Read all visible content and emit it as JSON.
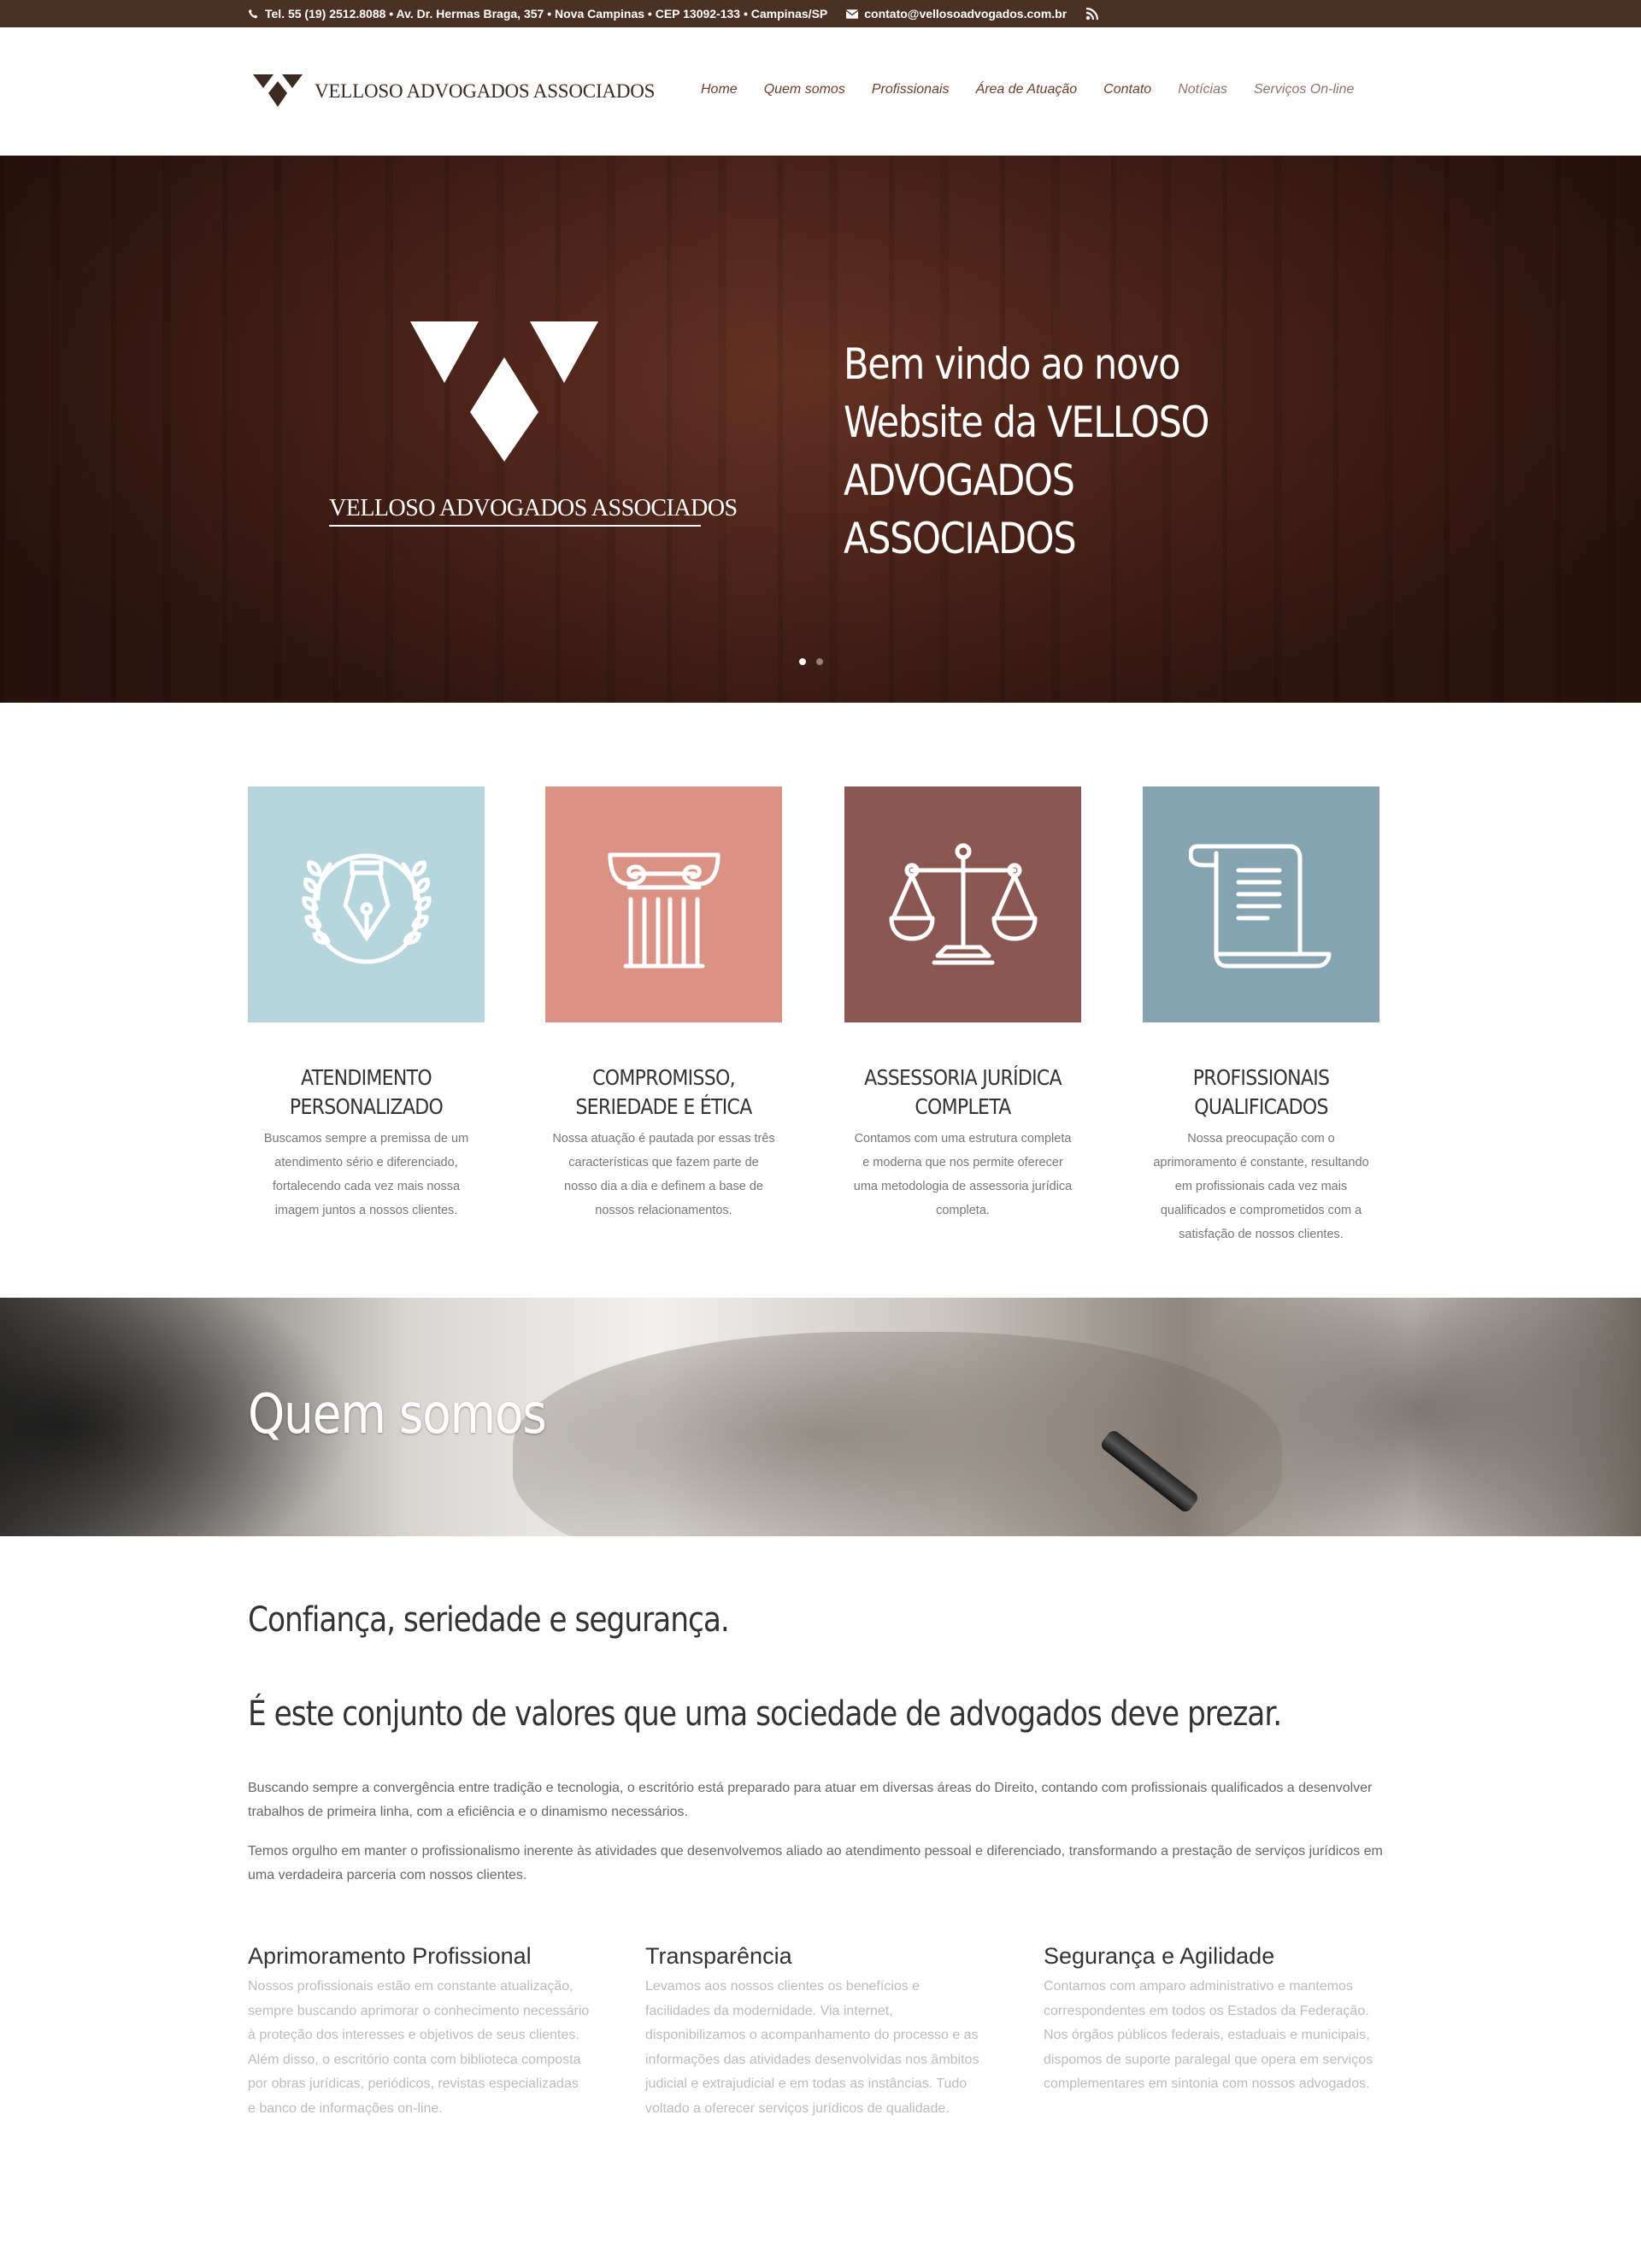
{
  "topbar": {
    "phone": "Tel. 55 (19) 2512.8088 • Av. Dr. Hermas Braga, 357 • Nova Campinas • CEP 13092-133 • Campinas/SP",
    "email": "contato@vellosoadvogados.com.br"
  },
  "header": {
    "logo_text": "VELLOSO ADVOGADOS ASSOCIADOS",
    "nav": [
      "Home",
      "Quem somos",
      "Profissionais",
      "Área de Atuação",
      "Contato",
      "Notícias",
      "Serviços On-line"
    ]
  },
  "hero": {
    "logo_text": "VELLOSO ADVOGADOS ASSOCIADOS",
    "title": "Bem vindo ao novo Website da VELLOSO ADVOGADOS ASSOCIADOS",
    "slides": 2,
    "active_slide": 1
  },
  "features": [
    {
      "icon": "fountain-pen-laurel-icon",
      "color": "#b7d5dd",
      "title_line1": "ATENDIMENTO",
      "title_line2": "PERSONALIZADO",
      "text": "Buscamos sempre a premissa de um atendimento sério e diferenciado, fortalecendo cada vez mais nossa imagem juntos a nossos clientes."
    },
    {
      "icon": "column-icon",
      "color": "#da9284",
      "title_line1": "COMPROMISSO,",
      "title_line2": "SERIEDADE E ÉTICA",
      "text": "Nossa atuação é pautada por essas três características que fazem parte de nosso dia a dia e definem a base de nossos relacionamentos."
    },
    {
      "icon": "scales-icon",
      "color": "#8a5752",
      "title_line1": "ASSESSORIA JURÍDICA",
      "title_line2": "COMPLETA",
      "text": "Contamos com uma estrutura completa e moderna que nos permite oferecer uma metodologia de assessoria jurídica completa."
    },
    {
      "icon": "scroll-document-icon",
      "color": "#86a3b1",
      "title_line1": "PROFISSIONAIS",
      "title_line2": "QUALIFICADOS",
      "text": "Nossa preocupação com o aprimoramento é constante, resultando em profissionais cada vez mais qualificados e comprometidos com a satisfação de nossos clientes."
    }
  ],
  "band": {
    "title": "Quem somos"
  },
  "about": {
    "heading1": "Confiança, seriedade e segurança.",
    "heading2": "É este conjunto de valores que uma sociedade de advogados deve prezar.",
    "paragraph1": "Buscando sempre a convergência entre tradição e tecnologia, o escritório está preparado para atuar em diversas áreas do Direito, contando com profissionais qualificados a desenvolver trabalhos de primeira linha, com a eficiência e o dinamismo necessários.",
    "paragraph2": "Temos orgulho em manter o profissionalismo inerente às atividades que desenvolvemos aliado ao atendimento pessoal e diferenciado, transformando a prestação de serviços jurídicos em uma verdadeira parceria com nossos clientes."
  },
  "columns": [
    {
      "title": "Aprimoramento Profissional",
      "text": "Nossos profissionais estão em constante atualização, sempre buscando aprimorar o conhecimento necessário à proteção dos interesses e objetivos de seus clientes. Além disso, o escritório conta com biblioteca composta por obras jurídicas, periódicos, revistas especializadas e banco de informações on-line."
    },
    {
      "title": "Transparência",
      "text": "Levamos aos nossos clientes os benefícios e facilidades da modernidade. Via internet, disponibilizamos o acompanhamento do processo e as informações das atividades desenvolvidas nos âmbitos judicial e extrajudicial e em todas as instâncias. Tudo voltado a oferecer serviços jurídicos de qualidade."
    },
    {
      "title": "Segurança e Agilidade",
      "text": "Contamos com amparo administrativo e mantemos correspondentes em todos os Estados da Federação. Nos órgãos públicos federais, estaduais e municipais, dispomos de suporte paralegal que opera em serviços complementares em sintonia com nossos advogados."
    }
  ]
}
